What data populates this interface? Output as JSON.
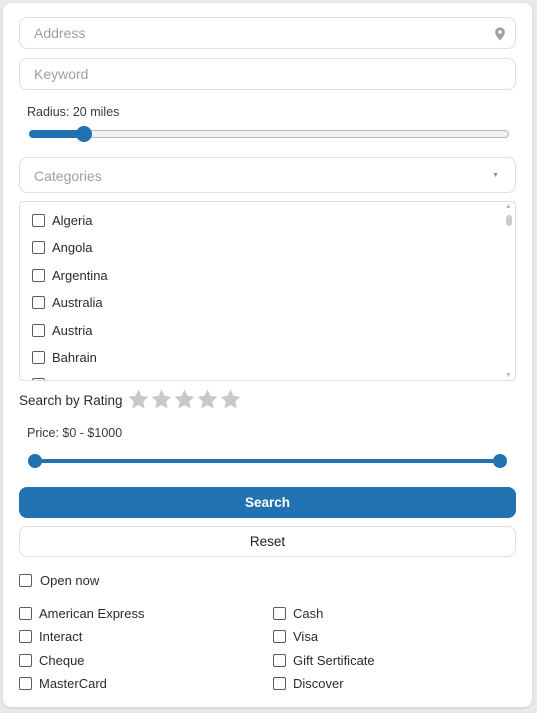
{
  "address": {
    "placeholder": "Address"
  },
  "keyword": {
    "placeholder": "Keyword"
  },
  "radius": {
    "label": "Radius: 20 miles",
    "value_fraction": 0.115
  },
  "categories": {
    "placeholder": "Categories"
  },
  "countries": [
    "Algeria",
    "Angola",
    "Argentina",
    "Australia",
    "Austria",
    "Bahrain"
  ],
  "rating": {
    "label": "Search by Rating",
    "stars": 5,
    "selected": 0
  },
  "price": {
    "label": "Price: $0 - $1000",
    "min": 0,
    "max": 1000
  },
  "buttons": {
    "search": "Search",
    "reset": "Reset"
  },
  "open_now": "Open now",
  "payments": {
    "left": [
      "American Express",
      "Interact",
      "Cheque",
      "MasterCard"
    ],
    "right": [
      "Cash",
      "Visa",
      "Gift Sertificate",
      "Discover"
    ]
  },
  "colors": {
    "accent": "#2271b1",
    "star": "#c8c8c8",
    "border": "#dcdfe4"
  }
}
